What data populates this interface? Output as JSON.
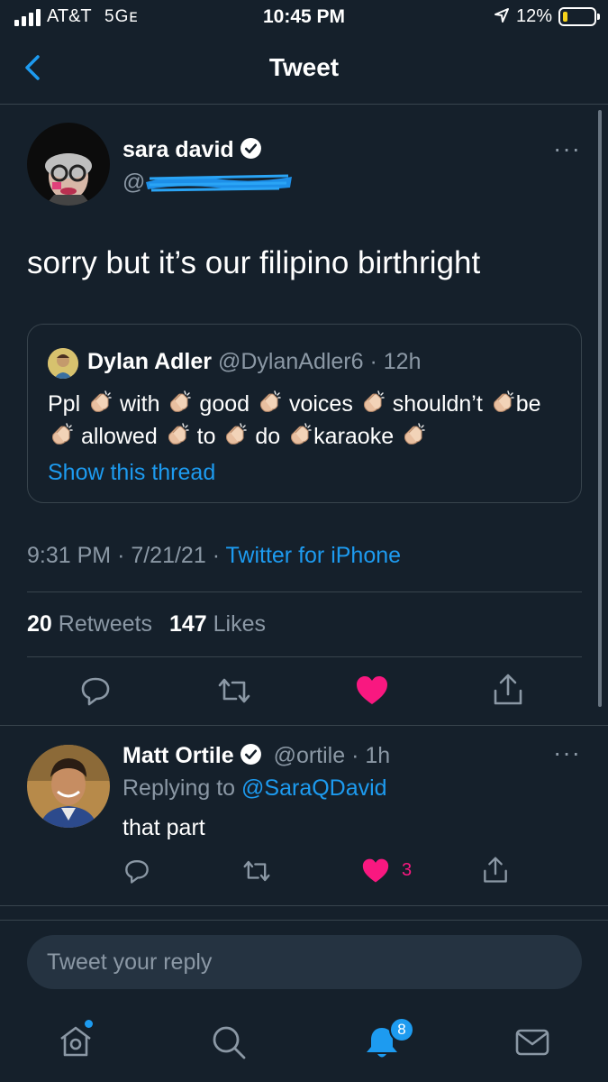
{
  "status_bar": {
    "carrier": "AT&T",
    "network": "5Gᴇ",
    "time": "10:45 PM",
    "battery_percent": "12%",
    "battery_level": 0.12,
    "battery_color": "#f5d21b"
  },
  "header": {
    "back_icon": "chevron-left-icon",
    "title": "Tweet"
  },
  "tweet": {
    "author_name": "sara david",
    "author_handle": "@",
    "handle_redacted": true,
    "verified": true,
    "text": "sorry but it’s our filipino birthright",
    "quoted": {
      "author_name": "Dylan Adler",
      "author_handle": "@DylanAdler6",
      "age": "· 12h",
      "words": [
        "Ppl",
        "with",
        "good",
        "voices",
        "shouldn’t",
        "be",
        "allowed",
        "to",
        "do",
        "karaoke"
      ],
      "emoji": "clapping-hands",
      "show_thread": "Show this thread"
    },
    "time": "9:31 PM",
    "date": "· 7/21/21 ·",
    "source": "Twitter for iPhone",
    "retweet_count": "20",
    "retweet_label": "Retweets",
    "like_count": "147",
    "like_label": "Likes",
    "liked": true
  },
  "reply": {
    "author_name": "Matt Ortile",
    "author_handle": "@ortile",
    "age": "· 1h",
    "verified": true,
    "replying_label": "Replying to",
    "replying_handle": "@SaraQDavid",
    "text": "that part",
    "like_count": "3",
    "liked": true
  },
  "compose": {
    "placeholder": "Tweet your reply"
  },
  "tabbar": {
    "items": [
      "home-icon",
      "search-icon",
      "notifications-icon",
      "messages-icon"
    ],
    "notifications_badge": "8"
  },
  "colors": {
    "background": "#15202b",
    "accent": "#1d9bf0",
    "like": "#f91880",
    "muted": "#8b98a5",
    "border": "#38444d"
  }
}
